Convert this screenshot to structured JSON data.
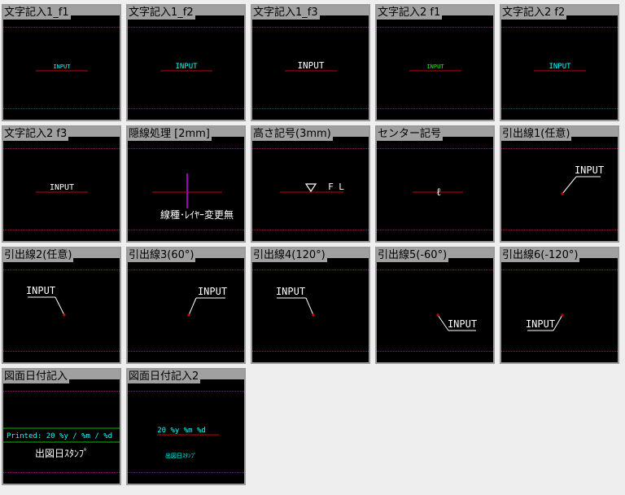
{
  "tiles": [
    {
      "title": "文字記入1_f1",
      "kind": "text",
      "text": "INPUT",
      "size": 7,
      "color": "#00ffff"
    },
    {
      "title": "文字記入1_f2",
      "kind": "text",
      "text": "INPUT",
      "size": 9,
      "color": "#00ffff"
    },
    {
      "title": "文字記入1_f3",
      "kind": "text",
      "text": "INPUT",
      "size": 11,
      "color": "#ffffff"
    },
    {
      "title": "文字記入2 f1",
      "kind": "text",
      "text": "INPUT",
      "size": 7,
      "color": "#00ff00"
    },
    {
      "title": "文字記入2 f2",
      "kind": "text",
      "text": "INPUT",
      "size": 9,
      "color": "#00ffff"
    },
    {
      "title": "文字記入2 f3",
      "kind": "text",
      "text": "INPUT",
      "size": 10,
      "color": "#ffffff"
    },
    {
      "title": "隠線処理 [2mm]",
      "kind": "hidden",
      "caption": "線種･ﾚｲﾔｰ変更無"
    },
    {
      "title": "高さ記号(3mm)",
      "kind": "height",
      "fl": "F L"
    },
    {
      "title": "センター記号",
      "kind": "center",
      "symbol": "ℓ"
    },
    {
      "title": "引出線1(任意)",
      "kind": "leader",
      "text": "INPUT"
    },
    {
      "title": "引出線2(任意)",
      "kind": "leader",
      "text": "INPUT"
    },
    {
      "title": "引出線3(60°)",
      "kind": "leader",
      "text": "INPUT"
    },
    {
      "title": "引出線4(120°)",
      "kind": "leader",
      "text": "INPUT"
    },
    {
      "title": "引出線5(-60°)",
      "kind": "leader",
      "text": "INPUT"
    },
    {
      "title": "引出線6(-120°)",
      "kind": "leader",
      "text": "INPUT"
    },
    {
      "title": "図面日付記入",
      "kind": "date1",
      "printed": "Printed:  20 %y / %m  / %d",
      "stamp": "出図日ｽﾀﾝﾌﾟ"
    },
    {
      "title": "図面日付記入2",
      "kind": "date2",
      "date": "20 %y %m %d",
      "stamp": "出図日ｽﾀﾝﾌﾟ"
    }
  ],
  "colors": {
    "background": "#000000",
    "red": "#cc0000",
    "text": "#ffffff",
    "cyan": "#00ffff",
    "green": "#00c000"
  }
}
